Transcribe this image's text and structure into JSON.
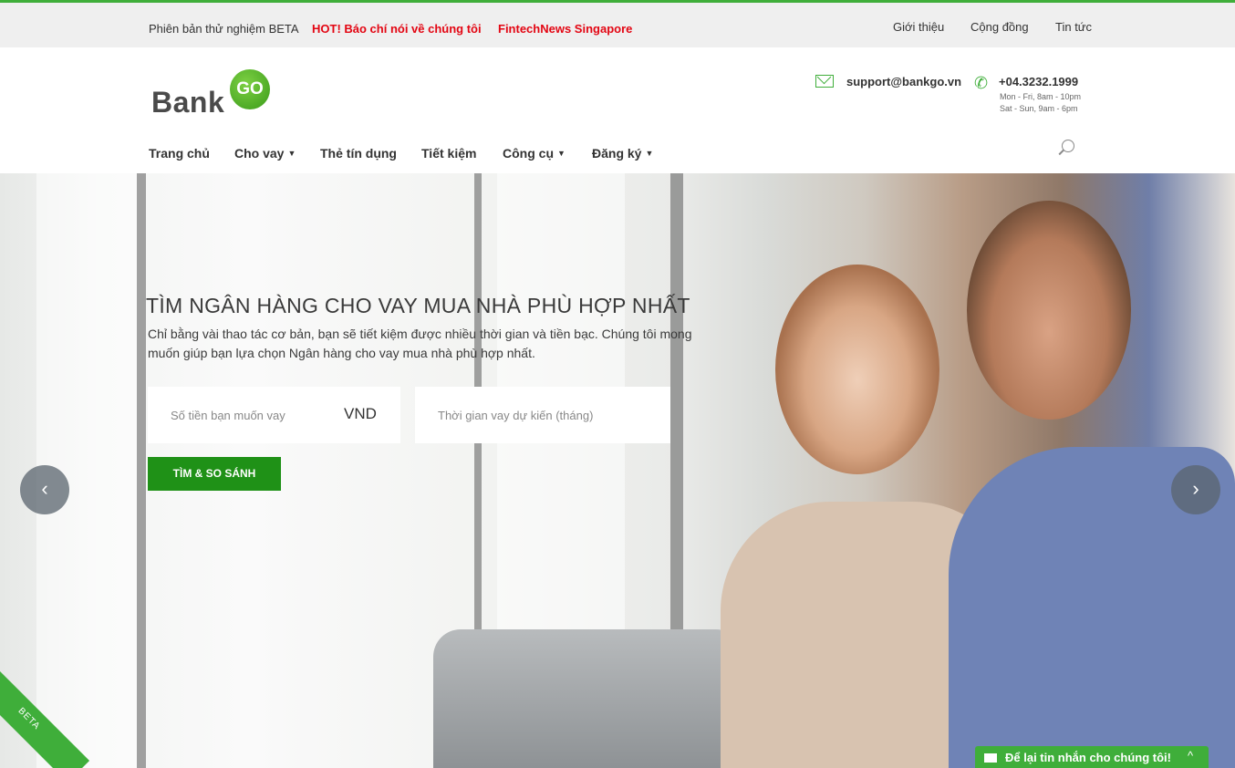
{
  "topbar": {
    "beta_notice": "Phiên bản thử nghiệm BETA",
    "hot_label": "HOT! Báo chí nói về chúng tôi",
    "press_link": "FintechNews Singapore",
    "links": [
      "Giới thiệu",
      "Cộng đồng",
      "Tin tức"
    ]
  },
  "header": {
    "logo_text": "Bank",
    "logo_badge": "GO",
    "email": "support@bankgo.vn",
    "phone": "+04.3232.1999",
    "hours": [
      "Mon - Fri, 8am - 10pm",
      "Sat - Sun, 9am - 6pm"
    ]
  },
  "nav": {
    "items": [
      {
        "label": "Trang chủ",
        "dropdown": false
      },
      {
        "label": "Cho vay",
        "dropdown": true
      },
      {
        "label": "Thẻ tín dụng",
        "dropdown": false
      },
      {
        "label": "Tiết kiệm",
        "dropdown": false
      },
      {
        "label": "Công cụ",
        "dropdown": true
      },
      {
        "label": "Đăng ký",
        "dropdown": true
      }
    ],
    "search_icon": "search-icon"
  },
  "hero": {
    "title": "TÌM NGÂN HÀNG CHO VAY MUA NHÀ PHÙ HỢP NHẤT",
    "subtitle": "Chỉ bằng vài thao tác cơ bản, bạn sẽ tiết kiệm được nhiều thời gian và tiền bạc. Chúng tôi mong muốn giúp bạn lựa chọn Ngân hàng cho vay mua nhà phù hợp nhất.",
    "amount_placeholder": "Số tiền bạn muốn vay",
    "amount_unit": "VND",
    "term_placeholder": "Thời gian vay dự kiến (tháng)",
    "search_button": "TÌM & SO SÁNH",
    "prev_arrow": "‹",
    "next_arrow": "›"
  },
  "badges": {
    "beta_ribbon": "BETA"
  },
  "chat": {
    "label": "Để lại tin nhắn cho chúng tôi!",
    "toggle": "^"
  },
  "colors": {
    "brand_green": "#3fae3a",
    "button_green": "#1f9117",
    "hot_red": "#e30613"
  }
}
